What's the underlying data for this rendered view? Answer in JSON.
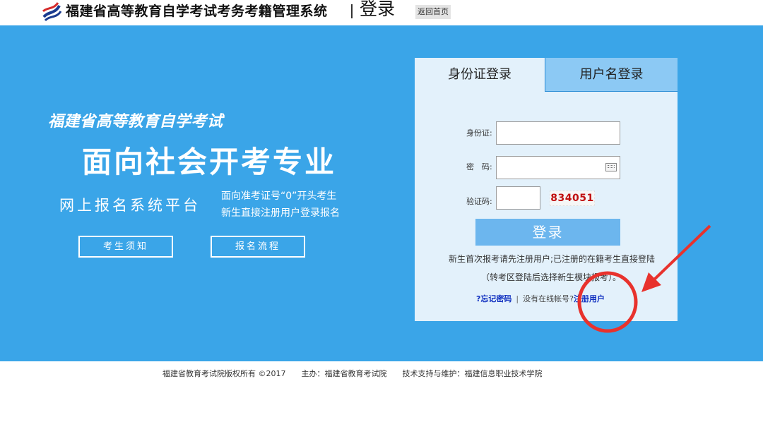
{
  "header": {
    "title": "福建省高等教育自学考试考务考籍管理系统",
    "login_word": "登录",
    "home_link": "返回首页"
  },
  "banner": {
    "slogan_small": "福建省高等教育自学考试",
    "slogan_big": "面向社会开考专业",
    "platform": "网上报名系统平台",
    "note_line1": "面向准考证号“0”开头考生",
    "note_line2": "新生直接注册用户登录报名",
    "btn_notice": "考生须知",
    "btn_process": "报名流程"
  },
  "login_panel": {
    "tab_id": "身份证登录",
    "tab_username": "用户名登录",
    "label_id": "身份证:",
    "label_password": "密　码:",
    "label_captcha": "验证码:",
    "captcha_text": "834051",
    "login_button": "登录",
    "hint_line1": "新生首次报考请先注册用户;已注册的在籍考生直接登陆",
    "hint_line2": "（转考区登陆后选择新生模块报考）。",
    "forgot_password": "?忘记密码",
    "no_account": "没有在线帐号?",
    "register": "注册用户"
  },
  "footer": {
    "copyright": "福建省教育考试院版权所有 ©2017　　主办：福建省教育考试院　　技术支持与维护：福建信息职业技术学院"
  },
  "colors": {
    "banner_blue": "#3aa5e8",
    "panel_bg": "#e3f1fb",
    "annotation_red": "#e8322d"
  }
}
